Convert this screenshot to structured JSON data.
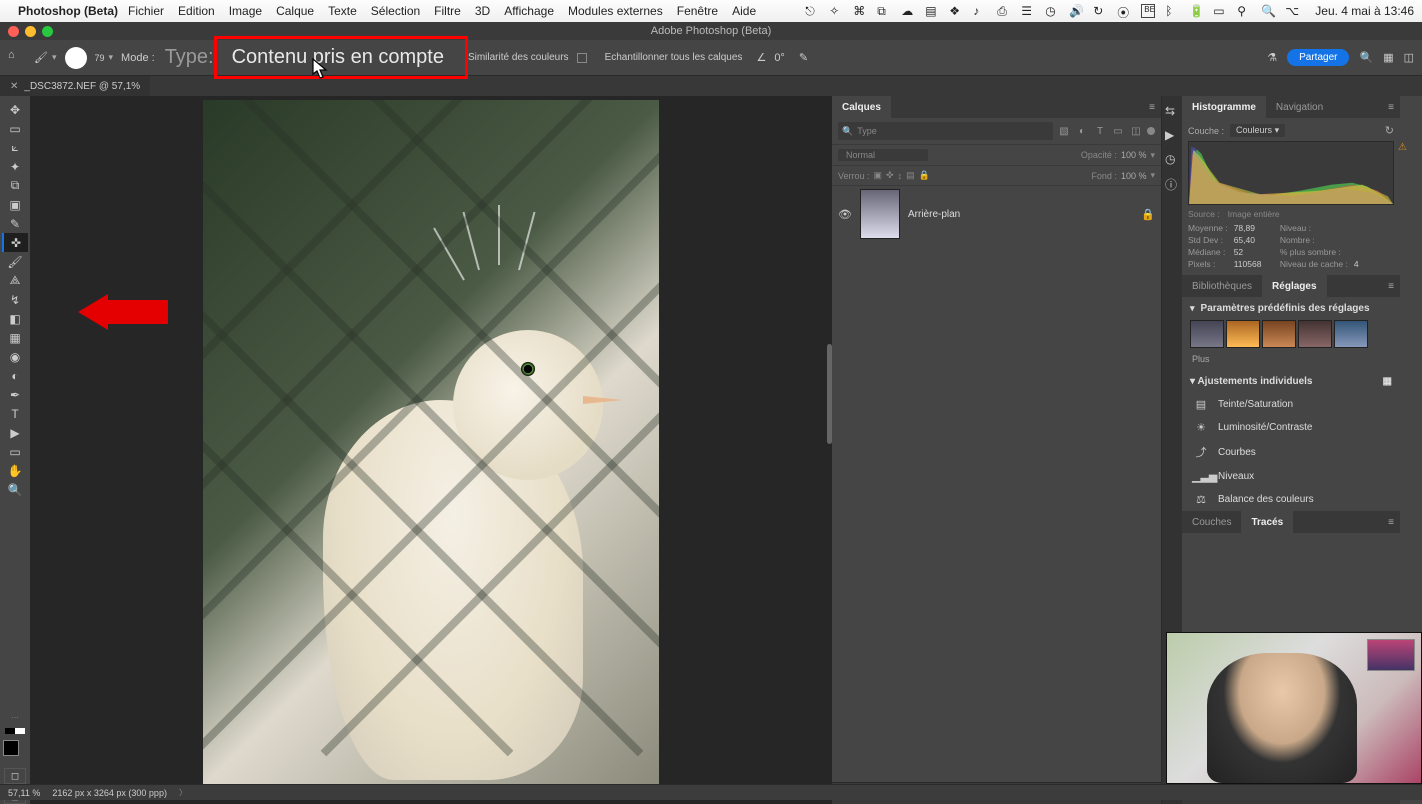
{
  "mac_menu": {
    "app": "Photoshop (Beta)",
    "items": [
      "Fichier",
      "Edition",
      "Image",
      "Calque",
      "Texte",
      "Sélection",
      "Filtre",
      "3D",
      "Affichage",
      "Modules externes",
      "Fenêtre",
      "Aide"
    ],
    "clock": "Jeu. 4 mai à 13:46",
    "be_box": "BE"
  },
  "window_title": "Adobe Photoshop (Beta)",
  "options": {
    "mode_label": "Mode :",
    "brush_size": "79",
    "type_label": "Type:",
    "type_value": "Contenu pris en compte",
    "similarity": "Similarité des couleurs",
    "sample_all": "Echantillonner tous les calques",
    "angle": "0°",
    "share": "Partager"
  },
  "doc_tab": {
    "name": "_DSC3872.NEF @ 57,1%"
  },
  "status": {
    "zoom": "57,11 %",
    "info": "2162 px x 3264 px (300 ppp)"
  },
  "layers_panel": {
    "tab": "Calques",
    "search_placeholder": "Type",
    "blend": "Normal",
    "opacity_label": "Opacité :",
    "opacity_value": "100 %",
    "lock_label": "Verrou :",
    "fill_label": "Fond :",
    "fill_value": "100 %",
    "layer_name": "Arrière-plan"
  },
  "histogram_panel": {
    "tab_histo": "Histogramme",
    "tab_nav": "Navigation",
    "channel_label": "Couche :",
    "channel_value": "Couleurs",
    "source_label": "Source :",
    "source_value": "Image entière",
    "stats": {
      "mean_l": "Moyenne :",
      "mean_v": "78,89",
      "std_l": "Std Dev :",
      "std_v": "65,40",
      "med_l": "Médiane :",
      "med_v": "52",
      "px_l": "Pixels :",
      "px_v": "110568",
      "lvl_l": "Niveau :",
      "lvl_v": "",
      "cnt_l": "Nombre :",
      "cnt_v": "",
      "pct_l": "% plus sombre :",
      "pct_v": "",
      "cache_l": "Niveau de cache :",
      "cache_v": "4"
    }
  },
  "reglages_panel": {
    "tab_lib": "Bibliothèques",
    "tab_reg": "Réglages",
    "presets_head": "Paramètres prédéfinis des réglages",
    "plus": "Plus",
    "individuals_head": "Ajustements individuels",
    "items": [
      "Teinte/Saturation",
      "Luminosité/Contraste",
      "Courbes",
      "Niveaux",
      "Balance des couleurs"
    ]
  },
  "paths_panel": {
    "tab_couches": "Couches",
    "tab_traces": "Tracés"
  }
}
